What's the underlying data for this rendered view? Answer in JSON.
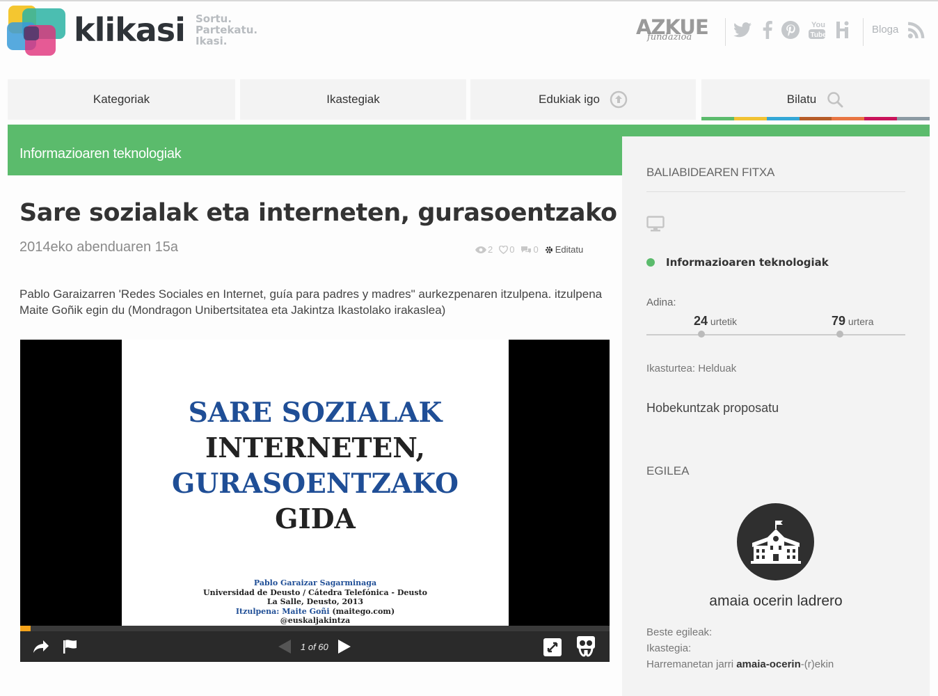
{
  "header": {
    "brand": "klikasi",
    "tagline": [
      "Sortu.",
      "Partekatu.",
      "Ikasi."
    ],
    "partner_logo": "AZKUE",
    "partner_logo_sub": "fundazioa",
    "social_icons": [
      "twitter-icon",
      "facebook-icon",
      "pinterest-icon",
      "youtube-icon",
      "hi-icon"
    ],
    "blog_label": "Bloga",
    "rss_icon": "rss-icon"
  },
  "nav": {
    "tabs": [
      {
        "label": "Kategoriak"
      },
      {
        "label": "Ikastegiak"
      },
      {
        "label": "Edukiak igo",
        "icon": "upload-icon"
      },
      {
        "label": "Bilatu",
        "icon": "search-icon"
      }
    ],
    "underline_colors": [
      "#5bbb6c",
      "#f1c232",
      "#33a7d6",
      "#b65c28",
      "#e87542",
      "#c9145a",
      "#8c9aa3"
    ]
  },
  "category_band": "Informazioaren teknologiak",
  "article": {
    "title": "Sare sozialak eta interneten, gurasoentzako gida",
    "date": "2014eko abenduaren 15a",
    "views": "2",
    "likes": "0",
    "comments": "0",
    "edit_label": "Editatu",
    "description": "Pablo Garaizarren 'Redes Sociales en Internet, guía para padres y madres\" aurkezpenaren itzulpena. itzulpena Maite Goñik egin du (Mondragon Unibertsitatea eta Jakintza Ikastolako irakaslea)"
  },
  "viewer": {
    "slide_title_1": "SARE SOZIALAK",
    "slide_title_2": "INTERNETEN,",
    "slide_title_3": "GURASOENTZAKO",
    "slide_title_4": "GIDA",
    "credit_1": "Pablo Garaizar Sagarminaga",
    "credit_2": "Universidad de Deusto / Cátedra Telefónica - Deusto",
    "credit_3": "La Salle, Deusto, 2013",
    "credit_4_label": "Itzulpena:",
    "credit_4_name": "Maite Goñi",
    "credit_4_rest": "(maitego.com)",
    "credit_5": "@euskaljakintza",
    "page_info": "1 of 60",
    "progress": 0.0167,
    "accent": "#f4a31a"
  },
  "sidebar": {
    "heading": "BALIABIDEAREN FITXA",
    "category": "Informazioaren teknologiak",
    "age_label": "Adina:",
    "age_from": "24",
    "age_from_unit": "urtetik",
    "age_to": "79",
    "age_to_unit": "urtera",
    "course": "Ikasturtea: Helduak",
    "suggest": "Hobekuntzak proposatu",
    "author_heading": "EGILEA",
    "author_name": "amaia ocerin ladrero",
    "other_authors": "Beste egileak:",
    "school": "Ikastegia:",
    "contact_prefix": "Harremanetan jarri",
    "contact_user": "amaia-ocerin",
    "contact_suffix": "-(r)ekin"
  },
  "colors": {
    "green": "#5bbb6c",
    "sidebar_bg": "#f3f3f3"
  }
}
